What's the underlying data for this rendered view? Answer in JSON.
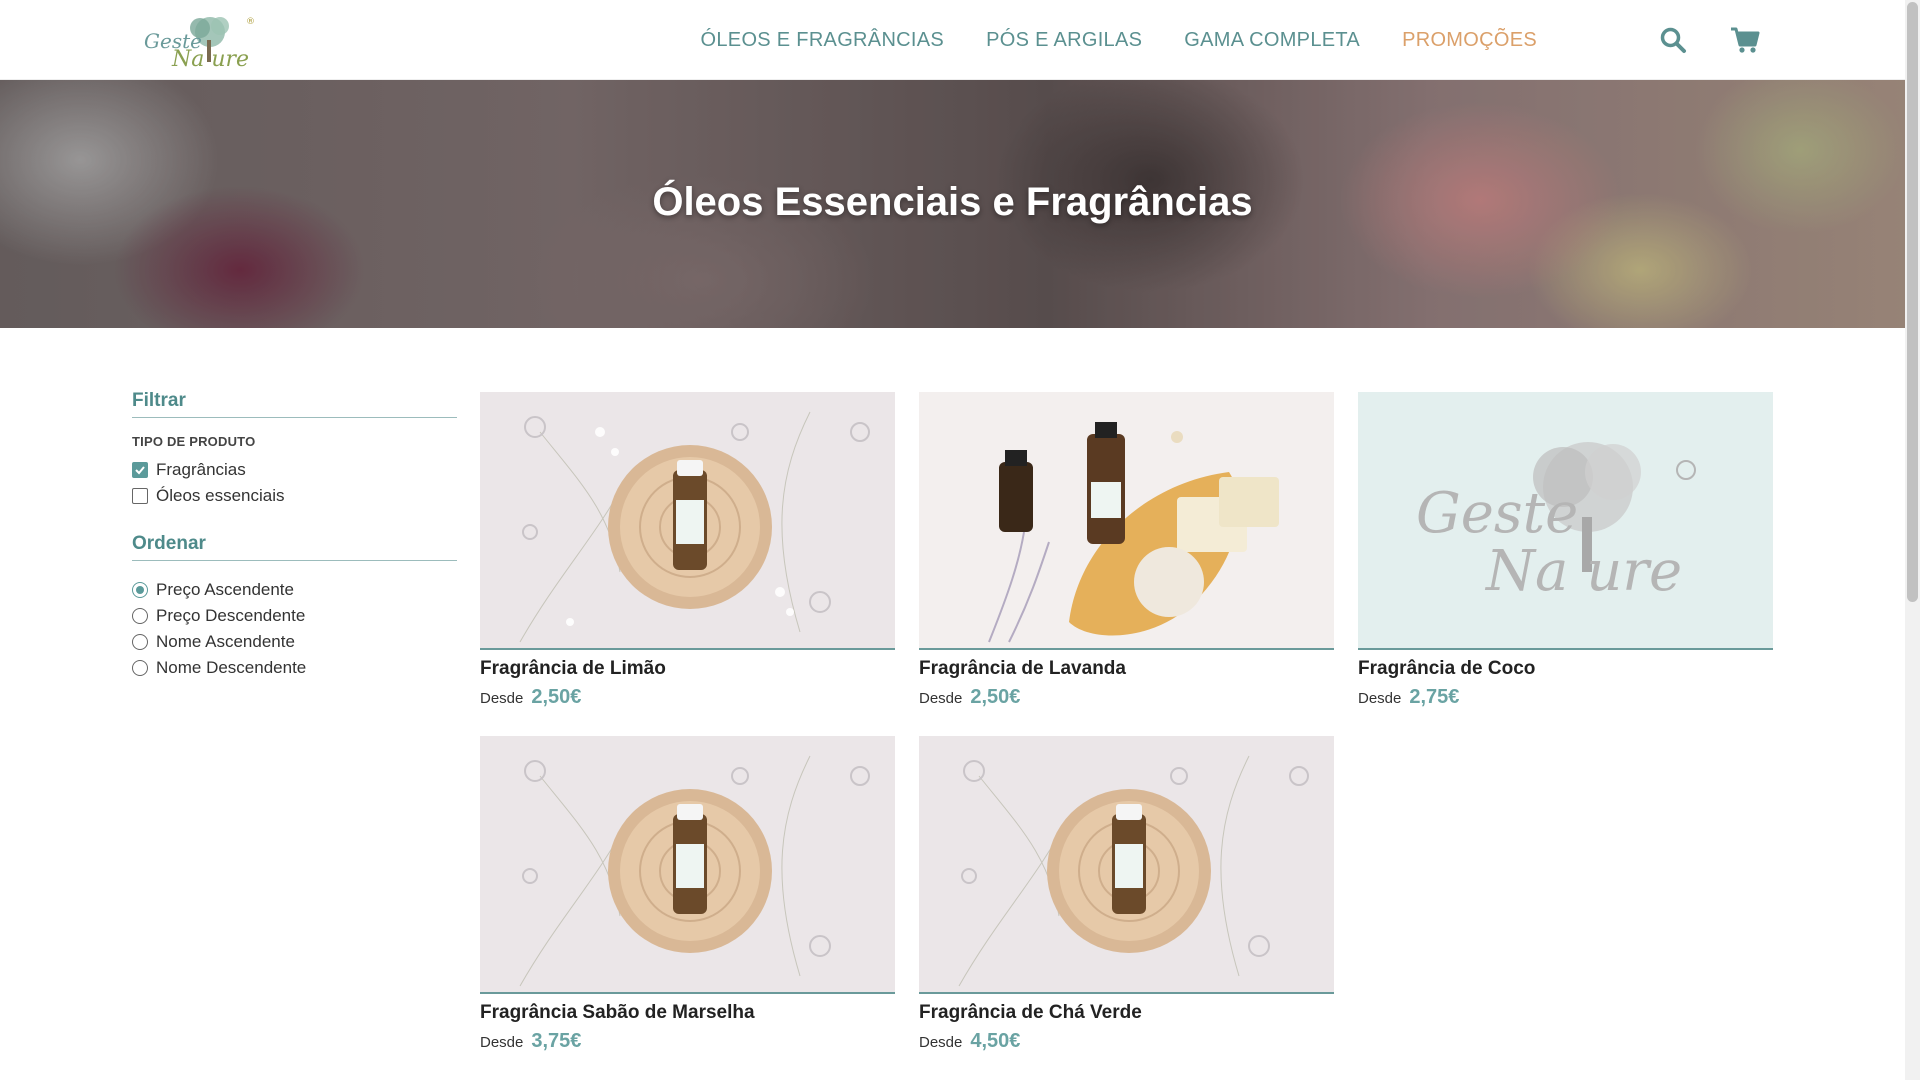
{
  "header": {
    "logo_alt": "Geste Nature",
    "nav": [
      {
        "label": "ÓLEOS E FRAGRÂNCIAS"
      },
      {
        "label": "PÓS E ARGILAS"
      },
      {
        "label": "GAMA COMPLETA"
      },
      {
        "label": "PROMOÇÕES"
      }
    ],
    "icons": {
      "search": "search-icon",
      "cart": "cart-icon"
    }
  },
  "hero": {
    "title": "Óleos Essenciais e Fragrâncias"
  },
  "sidebar": {
    "filter_heading": "Filtrar",
    "product_type_label": "TIPO DE PRODUTO",
    "product_types": [
      {
        "label": "Fragrâncias",
        "checked": true
      },
      {
        "label": "Óleos essenciais",
        "checked": false
      }
    ],
    "sort_heading": "Ordenar",
    "sort_options": [
      {
        "label": "Preço Ascendente",
        "selected": true
      },
      {
        "label": "Preço Descendente",
        "selected": false
      },
      {
        "label": "Nome Ascendente",
        "selected": false
      },
      {
        "label": "Nome Descendente",
        "selected": false
      }
    ]
  },
  "products": [
    {
      "name": "Fragrância de Limão",
      "from": "Desde",
      "price": "2,50€",
      "image": "bottle-on-wood-slice"
    },
    {
      "name": "Fragrância de Lavanda",
      "from": "Desde",
      "price": "2,50€",
      "image": "bottles-and-soaps"
    },
    {
      "name": "Fragrância de Coco",
      "from": "Desde",
      "price": "2,75€",
      "image": "geste-nature-logo-placeholder"
    },
    {
      "name": "Fragrância Sabão de Marselha",
      "from": "Desde",
      "price": "3,75€",
      "image": "bottle-on-wood-slice"
    },
    {
      "name": "Fragrância de Chá Verde",
      "from": "Desde",
      "price": "4,50€",
      "image": "bottle-on-wood-slice"
    }
  ],
  "colors": {
    "accent": "#5b9a9a",
    "promo": "#dba06a",
    "price": "#6aa3a3"
  }
}
